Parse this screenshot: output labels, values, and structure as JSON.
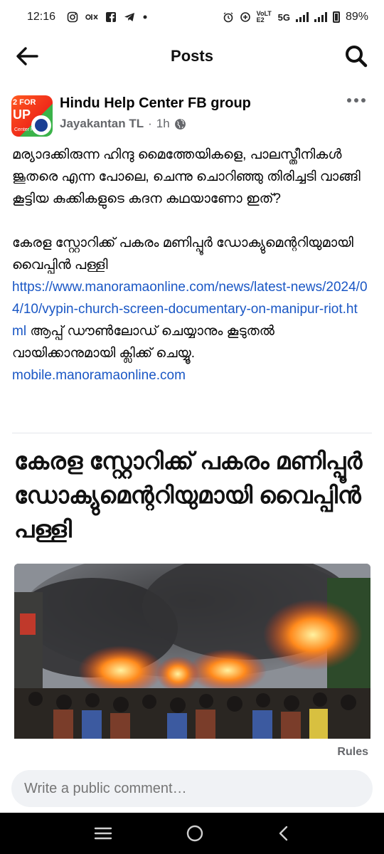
{
  "status_bar": {
    "time": "12:16",
    "left_icons": [
      "instagram-icon",
      "olx-icon",
      "facebook-icon",
      "telegram-icon",
      "dot-icon"
    ],
    "network_label": "VoLTE2",
    "network_type": "5G",
    "battery": "89%"
  },
  "app_bar": {
    "title": "Posts"
  },
  "post": {
    "group_name": "Hindu Help Center FB group",
    "author": "Jayakantan TL",
    "separator": "·",
    "time": "1h",
    "visibility": "public-globe-icon",
    "avatar_text_top": "2 FOR",
    "avatar_text_main": "UP",
    "avatar_text_small": "Center FB",
    "body_paragraph_1": "മര്യാദക്കിരുന്ന ഹിന്ദു മൈത്തേയികളെ, പാലസ്തീനികൾ ജൂതരെ എന്ന പോലെ, ചെന്നു ചൊറിഞ്ഞു തിരിച്ചടി വാങ്ങി കൂട്ടിയ കുക്കികളുടെ കദന കഥയാണോ ഇത്?",
    "body_paragraph_2": "കേരള സ്റ്റോറിക്ക് പകരം മണിപ്പൂർ ഡോക്യുമെന്ററിയുമായി വൈപ്പിൻ പള്ളി",
    "link_url": "https://www.manoramaonline.com/news/latest-news/2024/04/10/vypin-church-screen-documentary-on-manipur-riot.html",
    "body_after_link": " ആപ്പ് ഡൗൺലോഡ് ചെയ്യാനും കൂടുതൽ വായിക്കാനുമായി ക്ലിക്ക് ചെയ്യൂ.",
    "domain_link": "mobile.manoramaonline.com"
  },
  "article": {
    "title": "കേരള സ്റ്റോറിക്ക് പകരം മണിപ്പൂർ ഡോക്യുമെന്ററിയുമായി വൈപ്പിൻ പള്ളി"
  },
  "footer": {
    "rules_label": "Rules",
    "comment_placeholder": "Write a public comment…"
  },
  "nav_bar": {
    "icons": [
      "recents-icon",
      "home-icon",
      "back-icon"
    ]
  },
  "colors": {
    "link": "#1a57c5",
    "secondary_text": "#65676b",
    "comment_bg": "#f0f2f5",
    "nav_bg": "#000000"
  }
}
